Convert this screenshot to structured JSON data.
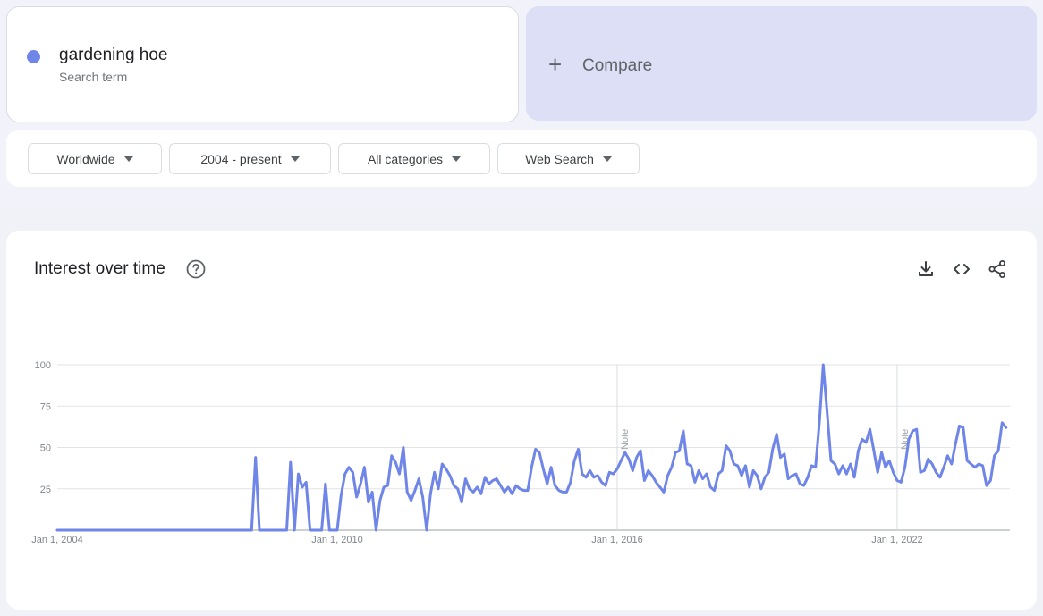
{
  "search": {
    "term": "gardening hoe",
    "term_subtitle": "Search term",
    "term_color": "#6f86e8",
    "compare_label": "Compare"
  },
  "filters": [
    {
      "label": "Worldwide",
      "icon": "caret-down-icon"
    },
    {
      "label": "2004 - present",
      "icon": "caret-down-icon"
    },
    {
      "label": "All categories",
      "icon": "caret-down-icon"
    },
    {
      "label": "Web Search",
      "icon": "caret-down-icon"
    }
  ],
  "chart_card": {
    "title": "Interest over time",
    "icons": [
      "help-icon",
      "download-icon",
      "embed-code-icon",
      "share-icon"
    ]
  },
  "chart_data": {
    "type": "line",
    "title": "",
    "xlabel": "",
    "ylabel": "",
    "ylim": [
      0,
      100
    ],
    "yticks": [
      "25",
      "50",
      "75",
      "100"
    ],
    "xticks": [
      "Jan 1, 2004",
      "Jan 1, 2010",
      "Jan 1, 2016",
      "Jan 1, 2022"
    ],
    "grid": true,
    "annotations": [
      {
        "label": "Note",
        "date": "2016-01"
      },
      {
        "label": "Note",
        "date": "2022-01"
      }
    ],
    "series": [
      {
        "name": "gardening hoe",
        "color": "#6f86e8",
        "points": [
          [
            "2004-01",
            0
          ],
          [
            "2008-02",
            0
          ],
          [
            "2008-03",
            0
          ],
          [
            "2008-04",
            44
          ],
          [
            "2008-05",
            0
          ],
          [
            "2008-12",
            0
          ],
          [
            "2009-01",
            41
          ],
          [
            "2009-02",
            0
          ],
          [
            "2009-03",
            34
          ],
          [
            "2009-04",
            26
          ],
          [
            "2009-05",
            29
          ],
          [
            "2009-06",
            0
          ],
          [
            "2009-09",
            0
          ],
          [
            "2009-10",
            28
          ],
          [
            "2009-11",
            0
          ],
          [
            "2010-01",
            0
          ],
          [
            "2010-02",
            21
          ],
          [
            "2010-03",
            34
          ],
          [
            "2010-04",
            38
          ],
          [
            "2010-05",
            35
          ],
          [
            "2010-06",
            20
          ],
          [
            "2010-07",
            28
          ],
          [
            "2010-08",
            38
          ],
          [
            "2010-09",
            17
          ],
          [
            "2010-10",
            23
          ],
          [
            "2010-11",
            0
          ],
          [
            "2010-12",
            18
          ],
          [
            "2011-01",
            26
          ],
          [
            "2011-02",
            27
          ],
          [
            "2011-03",
            45
          ],
          [
            "2011-04",
            41
          ],
          [
            "2011-05",
            34
          ],
          [
            "2011-06",
            50
          ],
          [
            "2011-07",
            23
          ],
          [
            "2011-08",
            18
          ],
          [
            "2011-09",
            24
          ],
          [
            "2011-10",
            31
          ],
          [
            "2011-11",
            20
          ],
          [
            "2011-12",
            0
          ],
          [
            "2012-01",
            22
          ],
          [
            "2012-02",
            35
          ],
          [
            "2012-03",
            25
          ],
          [
            "2012-04",
            40
          ],
          [
            "2012-05",
            37
          ],
          [
            "2012-06",
            33
          ],
          [
            "2012-07",
            27
          ],
          [
            "2012-08",
            25
          ],
          [
            "2012-09",
            17
          ],
          [
            "2012-10",
            31
          ],
          [
            "2012-11",
            25
          ],
          [
            "2012-12",
            23
          ],
          [
            "2013-01",
            26
          ],
          [
            "2013-02",
            22
          ],
          [
            "2013-03",
            32
          ],
          [
            "2013-04",
            28
          ],
          [
            "2013-05",
            30
          ],
          [
            "2013-06",
            31
          ],
          [
            "2013-07",
            27
          ],
          [
            "2013-08",
            23
          ],
          [
            "2013-09",
            26
          ],
          [
            "2013-10",
            22
          ],
          [
            "2013-11",
            27
          ],
          [
            "2013-12",
            25
          ],
          [
            "2014-01",
            24
          ],
          [
            "2014-02",
            24
          ],
          [
            "2014-03",
            38
          ],
          [
            "2014-04",
            49
          ],
          [
            "2014-05",
            47
          ],
          [
            "2014-06",
            37
          ],
          [
            "2014-07",
            28
          ],
          [
            "2014-08",
            38
          ],
          [
            "2014-09",
            27
          ],
          [
            "2014-10",
            24
          ],
          [
            "2014-11",
            23
          ],
          [
            "2014-12",
            23
          ],
          [
            "2015-01",
            29
          ],
          [
            "2015-02",
            42
          ],
          [
            "2015-03",
            49
          ],
          [
            "2015-04",
            34
          ],
          [
            "2015-05",
            32
          ],
          [
            "2015-06",
            36
          ],
          [
            "2015-07",
            32
          ],
          [
            "2015-08",
            33
          ],
          [
            "2015-09",
            29
          ],
          [
            "2015-10",
            27
          ],
          [
            "2015-11",
            35
          ],
          [
            "2015-12",
            34
          ],
          [
            "2016-01",
            37
          ],
          [
            "2016-02",
            42
          ],
          [
            "2016-03",
            47
          ],
          [
            "2016-04",
            43
          ],
          [
            "2016-05",
            36
          ],
          [
            "2016-06",
            44
          ],
          [
            "2016-07",
            48
          ],
          [
            "2016-08",
            30
          ],
          [
            "2016-09",
            36
          ],
          [
            "2016-10",
            33
          ],
          [
            "2016-11",
            29
          ],
          [
            "2016-12",
            26
          ],
          [
            "2017-01",
            23
          ],
          [
            "2017-02",
            33
          ],
          [
            "2017-03",
            38
          ],
          [
            "2017-04",
            47
          ],
          [
            "2017-05",
            48
          ],
          [
            "2017-06",
            60
          ],
          [
            "2017-07",
            40
          ],
          [
            "2017-08",
            39
          ],
          [
            "2017-09",
            29
          ],
          [
            "2017-10",
            36
          ],
          [
            "2017-11",
            31
          ],
          [
            "2017-12",
            34
          ],
          [
            "2018-01",
            26
          ],
          [
            "2018-02",
            24
          ],
          [
            "2018-03",
            34
          ],
          [
            "2018-04",
            36
          ],
          [
            "2018-05",
            51
          ],
          [
            "2018-06",
            48
          ],
          [
            "2018-07",
            40
          ],
          [
            "2018-08",
            39
          ],
          [
            "2018-09",
            33
          ],
          [
            "2018-10",
            39
          ],
          [
            "2018-11",
            26
          ],
          [
            "2018-12",
            36
          ],
          [
            "2019-01",
            33
          ],
          [
            "2019-02",
            25
          ],
          [
            "2019-03",
            32
          ],
          [
            "2019-04",
            35
          ],
          [
            "2019-05",
            49
          ],
          [
            "2019-06",
            58
          ],
          [
            "2019-07",
            44
          ],
          [
            "2019-08",
            46
          ],
          [
            "2019-09",
            31
          ],
          [
            "2019-10",
            33
          ],
          [
            "2019-11",
            34
          ],
          [
            "2019-12",
            28
          ],
          [
            "2020-01",
            27
          ],
          [
            "2020-02",
            32
          ],
          [
            "2020-03",
            39
          ],
          [
            "2020-04",
            38
          ],
          [
            "2020-05",
            65
          ],
          [
            "2020-06",
            100
          ],
          [
            "2020-07",
            71
          ],
          [
            "2020-08",
            42
          ],
          [
            "2020-09",
            40
          ],
          [
            "2020-10",
            34
          ],
          [
            "2020-11",
            39
          ],
          [
            "2020-12",
            34
          ],
          [
            "2021-01",
            40
          ],
          [
            "2021-02",
            32
          ],
          [
            "2021-03",
            48
          ],
          [
            "2021-04",
            55
          ],
          [
            "2021-05",
            53
          ],
          [
            "2021-06",
            61
          ],
          [
            "2021-07",
            48
          ],
          [
            "2021-08",
            35
          ],
          [
            "2021-09",
            47
          ],
          [
            "2021-10",
            38
          ],
          [
            "2021-11",
            42
          ],
          [
            "2021-12",
            35
          ],
          [
            "2022-01",
            30
          ],
          [
            "2022-02",
            29
          ],
          [
            "2022-03",
            38
          ],
          [
            "2022-04",
            55
          ],
          [
            "2022-05",
            60
          ],
          [
            "2022-06",
            61
          ],
          [
            "2022-07",
            35
          ],
          [
            "2022-08",
            36
          ],
          [
            "2022-09",
            43
          ],
          [
            "2022-10",
            40
          ],
          [
            "2022-11",
            35
          ],
          [
            "2022-12",
            32
          ],
          [
            "2023-01",
            38
          ],
          [
            "2023-02",
            45
          ],
          [
            "2023-03",
            40
          ],
          [
            "2023-04",
            52
          ],
          [
            "2023-05",
            63
          ],
          [
            "2023-06",
            62
          ],
          [
            "2023-07",
            42
          ],
          [
            "2023-08",
            40
          ],
          [
            "2023-09",
            38
          ],
          [
            "2023-10",
            40
          ],
          [
            "2023-11",
            39
          ],
          [
            "2023-12",
            27
          ],
          [
            "2024-01",
            30
          ],
          [
            "2024-02",
            45
          ],
          [
            "2024-03",
            48
          ],
          [
            "2024-04",
            65
          ],
          [
            "2024-05",
            62
          ]
        ]
      }
    ]
  }
}
